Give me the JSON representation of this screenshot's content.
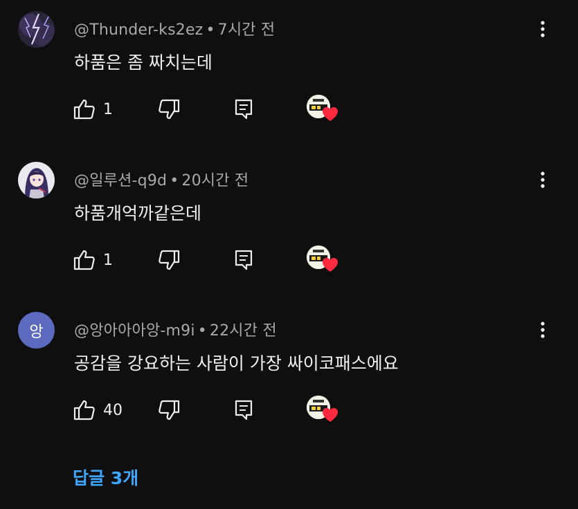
{
  "comments": [
    {
      "author": "@Thunder-ks2ez",
      "time": "7시간 전",
      "text": "하품은 좀 짜치는데",
      "likes": "1",
      "avatar_type": "thunder-image",
      "creator_heart": true
    },
    {
      "author": "@일루션-q9d",
      "time": "20시간 전",
      "text": "하품개억까같은데",
      "likes": "1",
      "avatar_type": "anime-image",
      "creator_heart": true
    },
    {
      "author": "@앙아아아앙-m9i",
      "time": "22시간 전",
      "text": "공감을 강요하는 사람이 가장 싸이코패스에요",
      "likes": "40",
      "avatar_type": "letter",
      "avatar_letter": "앙",
      "avatar_color": "#5c6bc0",
      "creator_heart": true
    }
  ],
  "separator": "•",
  "replies_label": "답글 3개",
  "colors": {
    "background": "#0f0f0f",
    "text": "#f1f1f1",
    "meta": "#aaaaaa",
    "link": "#3ea6ff",
    "heart": "#ff2a3d"
  },
  "icons": [
    "more-vert-icon",
    "thumb-up-icon",
    "thumb-down-icon",
    "reply-comment-icon",
    "creator-heart-icon"
  ]
}
